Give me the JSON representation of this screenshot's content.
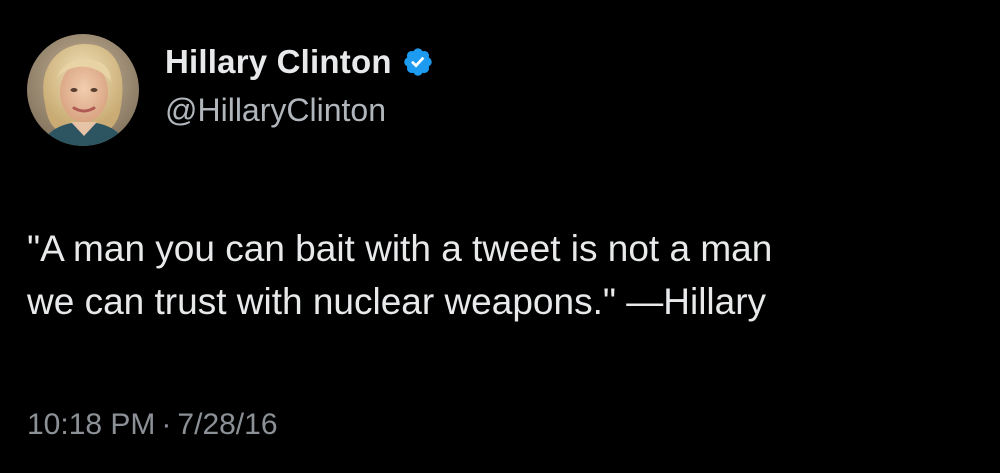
{
  "tweet": {
    "author": {
      "display_name": "Hillary Clinton",
      "handle": "@HillaryClinton",
      "verified": true,
      "avatar_icon": "profile-photo"
    },
    "text_lines": [
      "\"A man you can bait with a tweet is not a man",
      "we can trust with nuclear weapons.\" —Hillary"
    ],
    "time": "10:18 PM",
    "separator": "·",
    "date": "7/28/16"
  },
  "colors": {
    "background": "#000000",
    "primary_text": "#e7e9ea",
    "secondary_text": "#8b9197",
    "verified_badge": "#1d9bf0"
  }
}
